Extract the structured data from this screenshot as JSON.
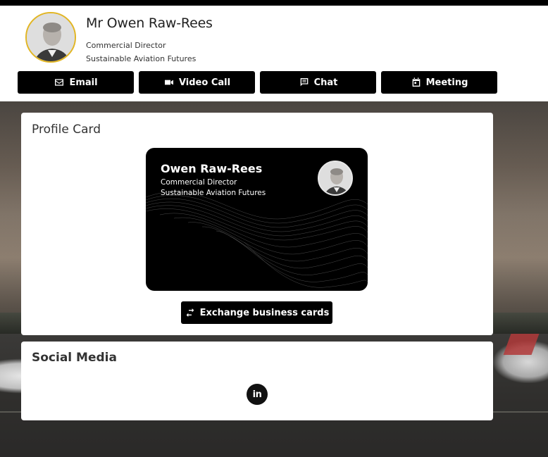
{
  "profile": {
    "full_name": "Mr Owen Raw-Rees",
    "title": "Commercial Director",
    "company": "Sustainable Aviation Futures"
  },
  "actions": [
    {
      "label": "Email",
      "icon": "email-icon"
    },
    {
      "label": "Video Call",
      "icon": "video-camera-icon"
    },
    {
      "label": "Chat",
      "icon": "chat-icon"
    },
    {
      "label": "Meeting",
      "icon": "calendar-icon"
    }
  ],
  "profile_card": {
    "heading": "Profile Card",
    "card_name": "Owen Raw-Rees",
    "card_title": "Commercial Director",
    "card_company": "Sustainable Aviation Futures",
    "exchange_label": "Exchange business cards"
  },
  "social": {
    "heading": "Social Media",
    "linkedin_text": "in"
  },
  "colors": {
    "accent_border": "#e2b624",
    "button_bg": "#000000",
    "panel_bg": "#ffffff"
  }
}
